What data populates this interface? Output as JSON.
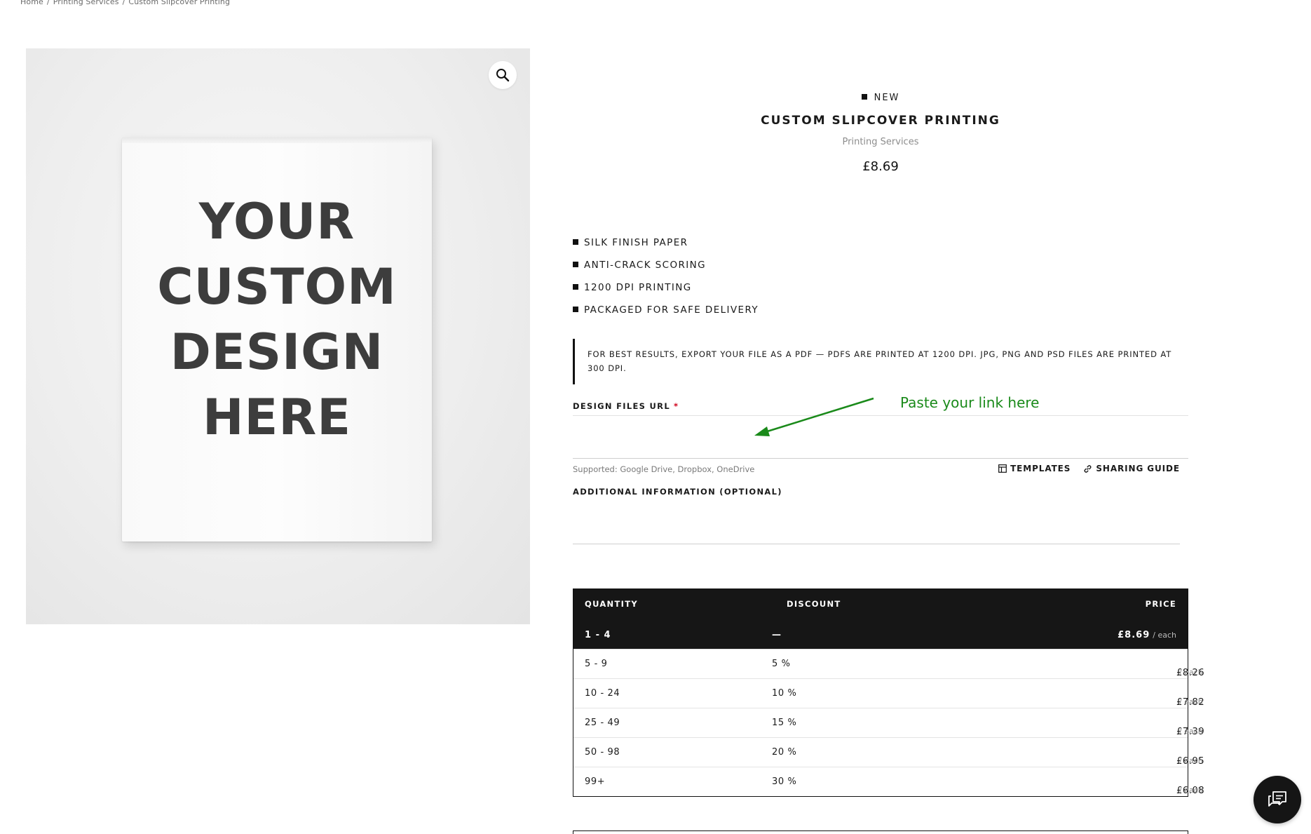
{
  "breadcrumb": {
    "items": [
      "Home",
      "Printing Services",
      "Custom Slipcover Printing"
    ],
    "separator": "/"
  },
  "gallery": {
    "image_text_lines": [
      "YOUR",
      "CUSTOM",
      "DESIGN",
      "HERE"
    ],
    "zoom_icon": "magnifier-icon"
  },
  "product": {
    "badge": "NEW",
    "title": "CUSTOM SLIPCOVER PRINTING",
    "category": "Printing Services",
    "price": "£8.69",
    "features": [
      "SILK FINISH PAPER",
      "ANTI-CRACK SCORING",
      "1200 DPI PRINTING",
      "PACKAGED FOR SAFE DELIVERY"
    ],
    "note": "FOR BEST RESULTS, EXPORT YOUR FILE AS A PDF — PDFS ARE PRINTED AT 1200 DPI. JPG, PNG AND PSD FILES ARE PRINTED AT 300 DPI."
  },
  "form": {
    "design_url_label": "DESIGN FILES URL",
    "required_mark": "*",
    "design_url_value": "",
    "supported_text": "Supported: Google Drive, Dropbox, OneDrive",
    "templates_label": "TEMPLATES",
    "sharing_guide_label": "SHARING GUIDE",
    "additional_label": "ADDITIONAL INFORMATION (OPTIONAL)",
    "additional_value": ""
  },
  "annotation": {
    "text": "Paste your link here",
    "color": "#1a8a1a"
  },
  "pricing_table": {
    "headers": {
      "quantity": "QUANTITY",
      "discount": "DISCOUNT",
      "price": "PRICE"
    },
    "each_label": "/ each",
    "rows": [
      {
        "quantity": "1 - 4",
        "discount": "—",
        "price": "£8.69",
        "active": true
      },
      {
        "quantity": "5 - 9",
        "discount": "5 %",
        "price": "£8.26"
      },
      {
        "quantity": "10 - 24",
        "discount": "10 %",
        "price": "£7.82"
      },
      {
        "quantity": "25 - 49",
        "discount": "15 %",
        "price": "£7.39"
      },
      {
        "quantity": "50 - 98",
        "discount": "20 %",
        "price": "£6.95"
      },
      {
        "quantity": "99+",
        "discount": "30 %",
        "price": "£6.08"
      }
    ]
  },
  "chat": {
    "icon": "chat-bubbles-icon"
  },
  "colors": {
    "dark": "#161616",
    "required": "#d0021b"
  }
}
